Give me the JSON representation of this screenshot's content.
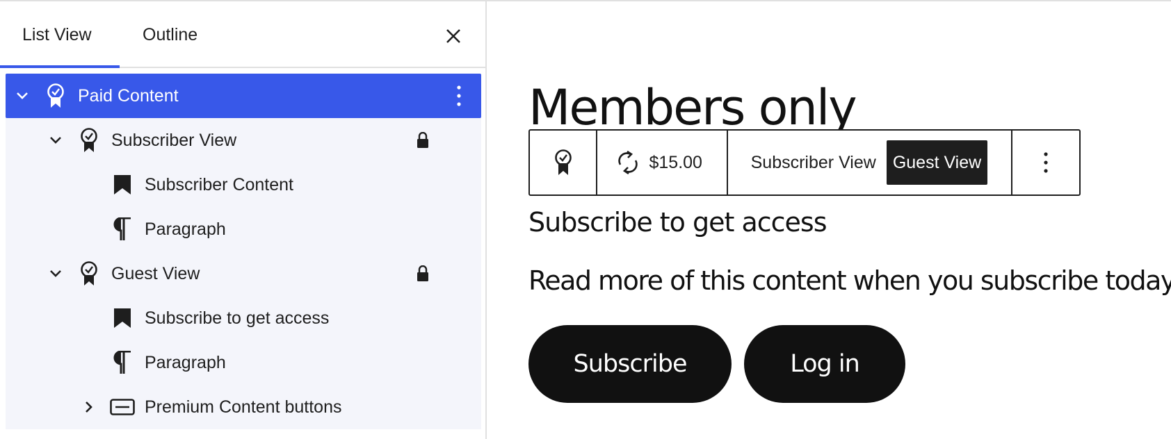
{
  "sidebar": {
    "tabs": [
      {
        "label": "List View",
        "active": true
      },
      {
        "label": "Outline",
        "active": false
      }
    ],
    "close_icon": "close-icon",
    "tree": [
      {
        "label": "Paid Content",
        "icon": "badge-icon",
        "expanded": true,
        "selected": true
      },
      {
        "label": "Subscriber View",
        "icon": "badge-icon",
        "expanded": true,
        "locked": true
      },
      {
        "label": "Subscriber Content",
        "icon": "bookmark-icon"
      },
      {
        "label": "Paragraph",
        "icon": "paragraph-icon"
      },
      {
        "label": "Guest View",
        "icon": "badge-icon",
        "expanded": true,
        "locked": true
      },
      {
        "label": "Subscribe to get access",
        "icon": "bookmark-icon"
      },
      {
        "label": "Paragraph",
        "icon": "paragraph-icon"
      },
      {
        "label": "Premium Content buttons",
        "icon": "button-icon",
        "expanded": false
      }
    ]
  },
  "canvas": {
    "heading": "Members only",
    "toolbar": {
      "price": "$15.00",
      "views": [
        {
          "label": "Subscriber View",
          "active": false
        },
        {
          "label": "Guest View",
          "active": true
        }
      ]
    },
    "sub_heading": "Subscribe to get access",
    "paragraph": "Read more of this content when you subscribe today.",
    "buttons": {
      "subscribe": "Subscribe",
      "login": "Log in"
    }
  },
  "colors": {
    "accent": "#3858e9",
    "tree_bg": "#f4f5fb",
    "dark": "#1e1e1e"
  }
}
